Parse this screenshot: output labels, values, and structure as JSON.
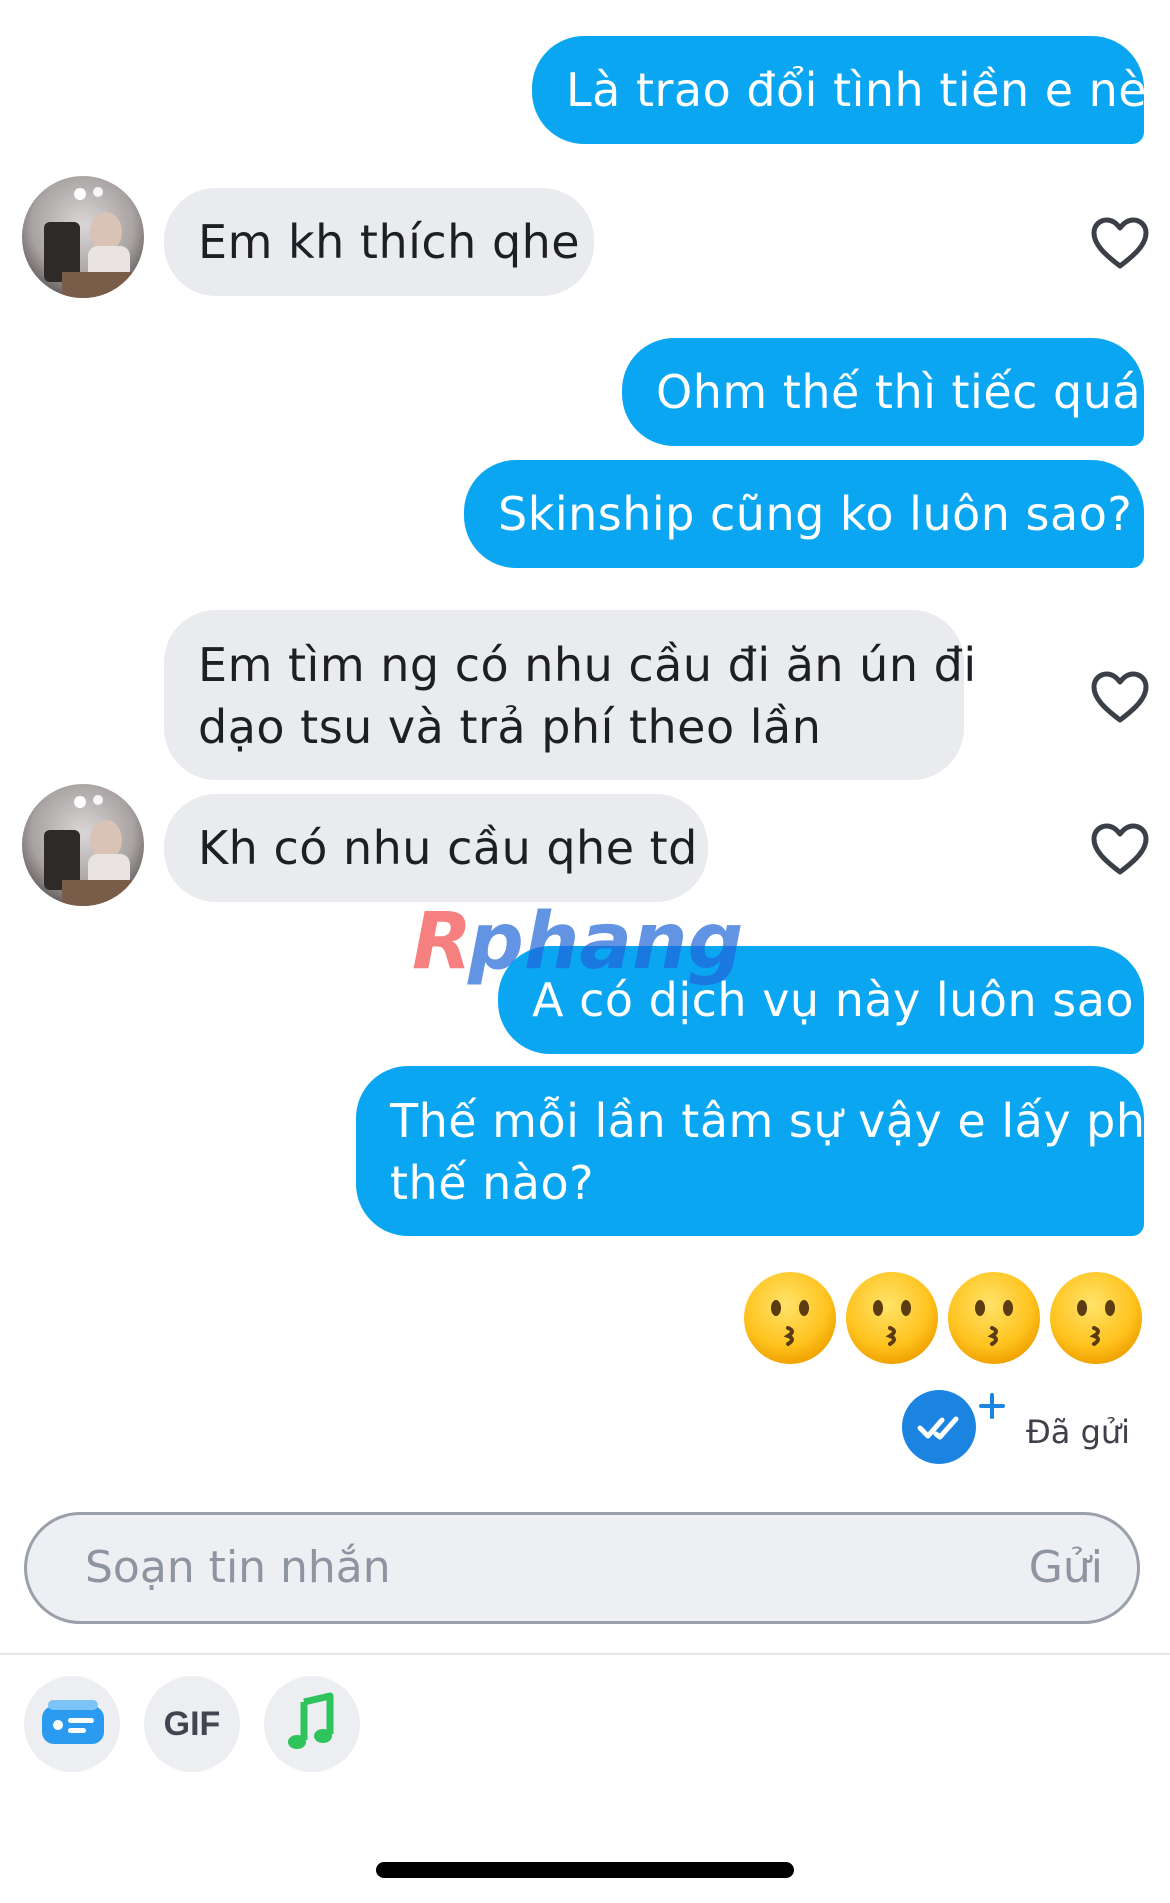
{
  "messages": [
    {
      "direction": "out",
      "lines": [
        "Là trao đổi tình tiền e nè"
      ]
    },
    {
      "direction": "in",
      "lines": [
        "Em kh thích qhe"
      ],
      "avatar": true,
      "liked": false
    },
    {
      "direction": "out",
      "lines": [
        "Ohm thế thì tiếc quá"
      ]
    },
    {
      "direction": "out",
      "lines": [
        "Skinship cũng ko luôn sao?"
      ]
    },
    {
      "direction": "in",
      "lines": [
        "Em tìm ng có nhu cầu đi ăn ún đi",
        "dạo tsu và trả phí theo lần"
      ],
      "avatar": false,
      "liked": false
    },
    {
      "direction": "in",
      "lines": [
        "Kh có nhu cầu qhe td"
      ],
      "avatar": true,
      "liked": false
    },
    {
      "direction": "out",
      "lines": [
        "A có dịch vụ này luôn sao"
      ]
    },
    {
      "direction": "out",
      "lines": [
        "Thế mỗi lần tâm sự vậy e lấy phí",
        "thế nào?"
      ]
    }
  ],
  "emoji_message": {
    "emojis": [
      "kissing-face",
      "kissing-face",
      "kissing-face",
      "kissing-face"
    ]
  },
  "status": {
    "text": "Đã gửi",
    "icon": "double-check-icon",
    "extra_icon": "plus-icon"
  },
  "composer": {
    "placeholder": "Soạn tin nhắn",
    "send_label": "Gửi"
  },
  "toolbar": [
    {
      "name": "card-icon",
      "label": ""
    },
    {
      "name": "gif-icon",
      "label": "GIF"
    },
    {
      "name": "music-note-icon",
      "label": ""
    }
  ],
  "watermark": {
    "text": "Rphang"
  },
  "colors": {
    "outgoing_bubble": "#0aa6f2",
    "incoming_bubble": "#eaebef",
    "read_badge": "#1a84e0",
    "music_icon": "#2fc35b",
    "card_icon": "#2a9bf0"
  }
}
